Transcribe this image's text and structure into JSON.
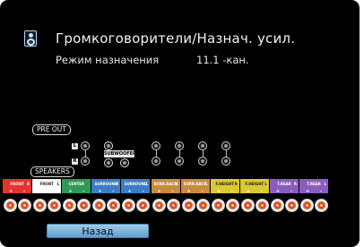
{
  "header": {
    "title": "Громкоговорители/Назнач. усил.",
    "icon": "speaker-icon"
  },
  "settings": {
    "mode_label": "Режим назначения",
    "mode_value": "11.1 -кан."
  },
  "pre_out": {
    "label": "PRE OUT",
    "left_marker": "L",
    "right_marker": "R",
    "subwoofer_label": "SUBWOOFER",
    "subwoofer_numbers": [
      "1",
      "2"
    ]
  },
  "speakers": {
    "label": "SPEAKERS",
    "channels": [
      {
        "label": "FRONT",
        "side": "R",
        "plus": "+",
        "minus": "-",
        "color": "#e0342f"
      },
      {
        "label": "FRONT",
        "side": "L",
        "plus": "+",
        "minus": "-",
        "color": "#f2f2f2"
      },
      {
        "label": "CENTER",
        "side": "",
        "plus": "+",
        "minus": "-",
        "color": "#2e9a55"
      },
      {
        "label": "SURROUND",
        "side": "R",
        "plus": "+",
        "minus": "-",
        "color": "#3a7cc9"
      },
      {
        "label": "SURROUND",
        "side": "L",
        "plus": "+",
        "minus": "-",
        "color": "#3a7cc9"
      },
      {
        "label": "SURR.BACK",
        "side": "R",
        "plus": "+",
        "minus": "-",
        "color": "#c98a3c"
      },
      {
        "label": "SURR.BACK",
        "side": "L",
        "plus": "+",
        "minus": "-",
        "color": "#c98a3c"
      },
      {
        "label": "F.HEIGHT",
        "side": "R",
        "plus": "+",
        "minus": "-",
        "color": "#d9c934"
      },
      {
        "label": "F.HEIGHT",
        "side": "L",
        "plus": "+",
        "minus": "-",
        "color": "#d9c934"
      },
      {
        "label": "T.REAR",
        "side": "R",
        "plus": "+",
        "minus": "-",
        "color": "#8a5cc2"
      },
      {
        "label": "T.REAR",
        "side": "L",
        "plus": "+",
        "minus": "-",
        "color": "#8a5cc2"
      }
    ]
  },
  "footer": {
    "back_label": "Назад"
  },
  "colors": {
    "background": "#000000",
    "button": "#7fb3dc",
    "terminal": "#c6461e"
  }
}
